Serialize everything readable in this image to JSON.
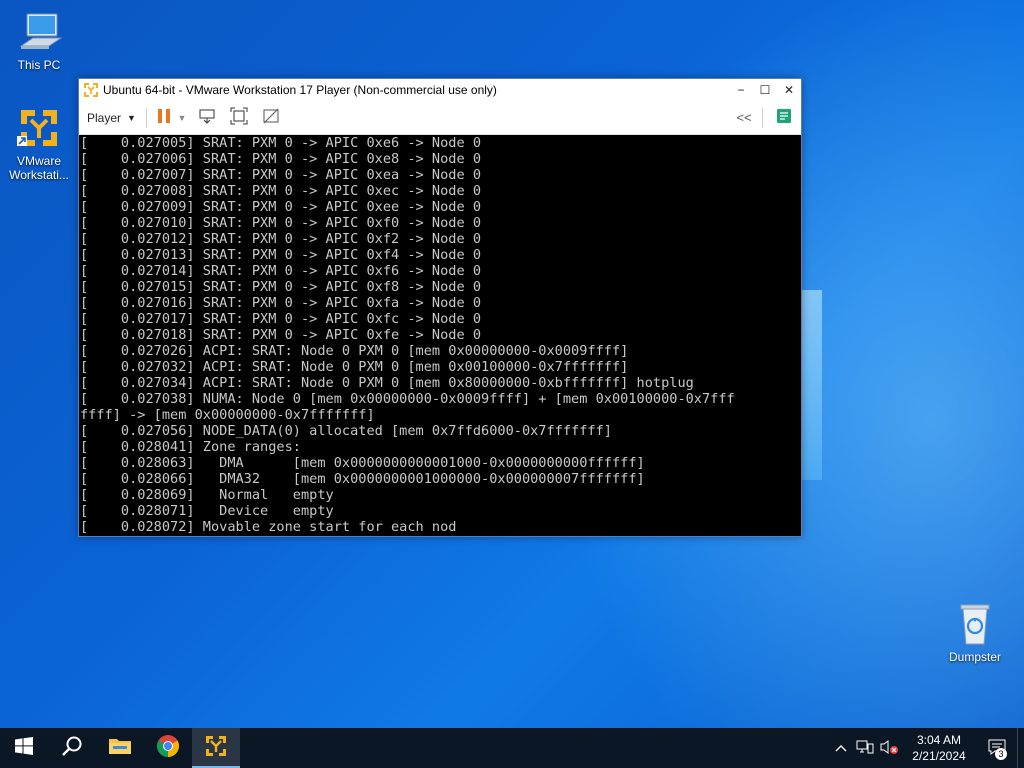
{
  "desktop": {
    "icons": [
      {
        "label": "This PC",
        "icon": "computer-icon"
      },
      {
        "label": "VMware\nWorkstati...",
        "icon": "vmware-icon"
      },
      {
        "label": "Dumpster",
        "icon": "recycle-bin-icon"
      }
    ]
  },
  "window": {
    "title": "Ubuntu 64-bit - VMware Workstation 17 Player (Non-commercial use only)",
    "controls": {
      "minimize": "−",
      "maximize": "☐",
      "close": "✕"
    },
    "toolbar": {
      "player_label": "Player",
      "collapse_label": "<<"
    },
    "console_lines": [
      "[    0.027005] SRAT: PXM 0 -> APIC 0xe6 -> Node 0",
      "[    0.027006] SRAT: PXM 0 -> APIC 0xe8 -> Node 0",
      "[    0.027007] SRAT: PXM 0 -> APIC 0xea -> Node 0",
      "[    0.027008] SRAT: PXM 0 -> APIC 0xec -> Node 0",
      "[    0.027009] SRAT: PXM 0 -> APIC 0xee -> Node 0",
      "[    0.027010] SRAT: PXM 0 -> APIC 0xf0 -> Node 0",
      "[    0.027012] SRAT: PXM 0 -> APIC 0xf2 -> Node 0",
      "[    0.027013] SRAT: PXM 0 -> APIC 0xf4 -> Node 0",
      "[    0.027014] SRAT: PXM 0 -> APIC 0xf6 -> Node 0",
      "[    0.027015] SRAT: PXM 0 -> APIC 0xf8 -> Node 0",
      "[    0.027016] SRAT: PXM 0 -> APIC 0xfa -> Node 0",
      "[    0.027017] SRAT: PXM 0 -> APIC 0xfc -> Node 0",
      "[    0.027018] SRAT: PXM 0 -> APIC 0xfe -> Node 0",
      "[    0.027026] ACPI: SRAT: Node 0 PXM 0 [mem 0x00000000-0x0009ffff]",
      "[    0.027032] ACPI: SRAT: Node 0 PXM 0 [mem 0x00100000-0x7fffffff]",
      "[    0.027034] ACPI: SRAT: Node 0 PXM 0 [mem 0x80000000-0xbfffffff] hotplug",
      "[    0.027038] NUMA: Node 0 [mem 0x00000000-0x0009ffff] + [mem 0x00100000-0x7fff",
      "ffff] -> [mem 0x00000000-0x7fffffff]",
      "[    0.027056] NODE_DATA(0) allocated [mem 0x7ffd6000-0x7fffffff]",
      "[    0.028041] Zone ranges:",
      "[    0.028063]   DMA      [mem 0x0000000000001000-0x0000000000ffffff]",
      "[    0.028066]   DMA32    [mem 0x0000000001000000-0x000000007fffffff]",
      "[    0.028069]   Normal   empty",
      "[    0.028071]   Device   empty",
      "[    0.028072] Movable zone start for each nod"
    ]
  },
  "taskbar": {
    "items": [
      "windows-start-icon",
      "search-icon",
      "file-explorer-icon",
      "chrome-icon",
      "vmware-player-icon"
    ],
    "clock": {
      "time": "3:04 AM",
      "date": "2/21/2024"
    },
    "notification_count": "3"
  },
  "colors": {
    "taskbar_bg": "#0c1726",
    "console_bg": "#000000",
    "console_text": "#c8c8c8",
    "pause_orange": "#e87722",
    "vmware_yellow": "#f3b21b"
  }
}
